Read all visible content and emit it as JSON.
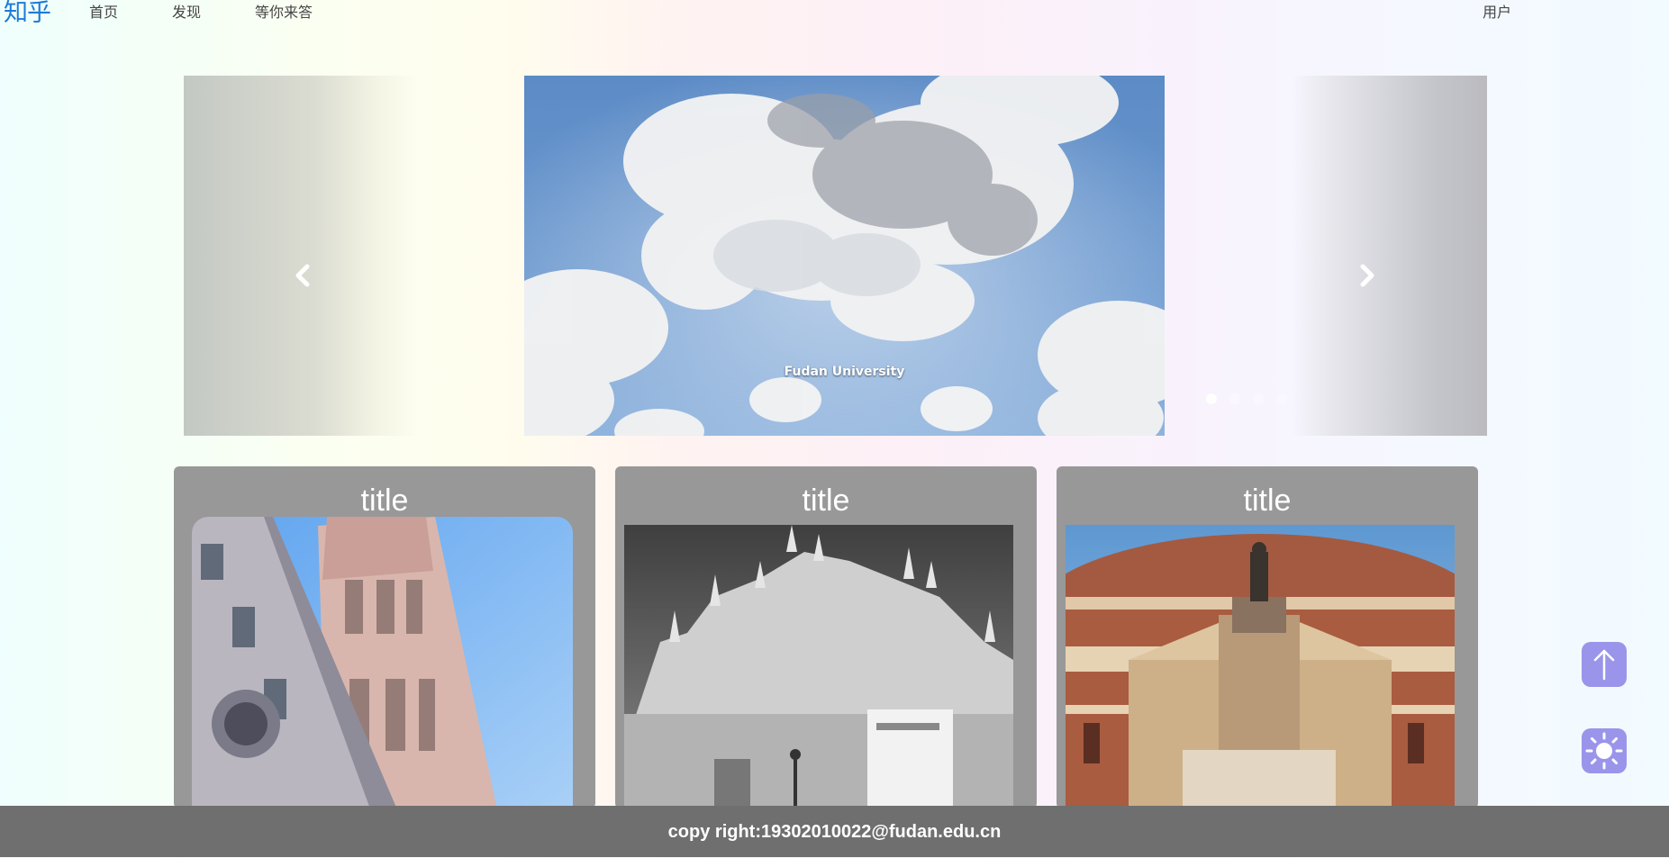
{
  "header": {
    "logo_text": "知乎",
    "nav": [
      "首页",
      "发现",
      "等你来答"
    ],
    "user_label": "用户"
  },
  "carousel": {
    "caption": "Fudan University",
    "slide_count": 4,
    "active_index": 0,
    "prev_icon": "chevron-left-icon",
    "next_icon": "chevron-right-icon"
  },
  "cards": [
    {
      "title": "title",
      "image": "florence-cathedral-bell-tower"
    },
    {
      "title": "title",
      "image": "milan-cathedral-grayscale"
    },
    {
      "title": "title",
      "image": "royal-albert-hall-statue"
    }
  ],
  "floating_buttons": {
    "top_icon": "arrow-up-icon",
    "theme_icon": "sun-icon",
    "color": "#9a95ea"
  },
  "footer": {
    "text": "copy right:19302010022@fudan.edu.cn"
  }
}
